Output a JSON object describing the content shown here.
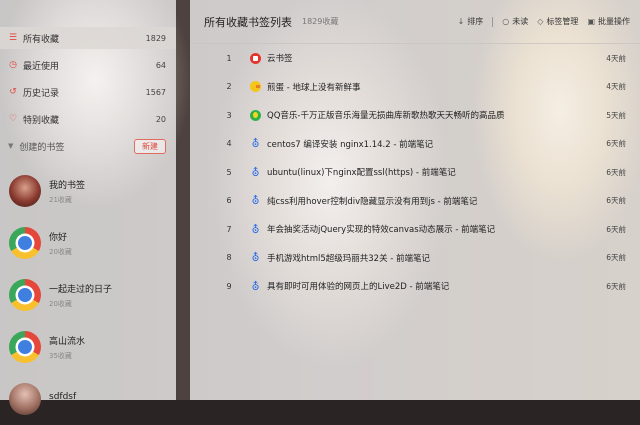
{
  "sidebar": {
    "nav": [
      {
        "icon": "list-icon",
        "glyph": "☰",
        "label": "所有收藏",
        "count": "1829"
      },
      {
        "icon": "clock-icon",
        "glyph": "◷",
        "label": "最近使用",
        "count": "64"
      },
      {
        "icon": "history-icon",
        "glyph": "↺",
        "label": "历史记录",
        "count": "1567"
      },
      {
        "icon": "heart-icon",
        "glyph": "♡",
        "label": "特别收藏",
        "count": "20"
      }
    ],
    "created_label": "创建的书签",
    "new_label": "新建",
    "folders": [
      {
        "name": "我的书签",
        "sub": "21收藏",
        "avatar": "photo"
      },
      {
        "name": "你好",
        "sub": "20收藏",
        "avatar": "chrome"
      },
      {
        "name": "一起走过的日子",
        "sub": "20收藏",
        "avatar": "chrome"
      },
      {
        "name": "高山流水",
        "sub": "35收藏",
        "avatar": "chrome"
      },
      {
        "name": "sdfdsf",
        "sub": "",
        "avatar": "photo2"
      }
    ]
  },
  "main": {
    "title": "所有收藏书签列表",
    "count": "1829收藏",
    "actions": {
      "sort": "排序",
      "unread": "未读",
      "tag_manage": "标签管理",
      "batch": "批量操作"
    },
    "rows": [
      {
        "idx": "1",
        "fav": "yun",
        "title": "云书签",
        "time": "4天前"
      },
      {
        "idx": "2",
        "fav": "chick",
        "title": "煎蛋 - 地球上没有新鲜事",
        "time": "4天前"
      },
      {
        "idx": "3",
        "fav": "qq",
        "title": "QQ音乐-千万正版音乐海量无损曲库新歌热歌天天畅听的高品质",
        "time": "5天前"
      },
      {
        "idx": "4",
        "fav": "deer",
        "title": "centos7 编译安装 nginx1.14.2 - 前端笔记",
        "time": "6天前"
      },
      {
        "idx": "5",
        "fav": "deer",
        "title": "ubuntu(linux)下nginx配置ssl(https) - 前端笔记",
        "time": "6天前"
      },
      {
        "idx": "6",
        "fav": "deer",
        "title": "纯css利用hover控制div隐藏显示没有用到js - 前端笔记",
        "time": "6天前"
      },
      {
        "idx": "7",
        "fav": "deer",
        "title": "年会抽奖活动jQuery实现的特效canvas动态展示 - 前端笔记",
        "time": "6天前"
      },
      {
        "idx": "8",
        "fav": "deer",
        "title": "手机游戏html5超级玛丽共32关 - 前端笔记",
        "time": "6天前"
      },
      {
        "idx": "9",
        "fav": "deer",
        "title": "具有即时可用体验的网页上的Live2D - 前端笔记",
        "time": "6天前"
      }
    ]
  }
}
